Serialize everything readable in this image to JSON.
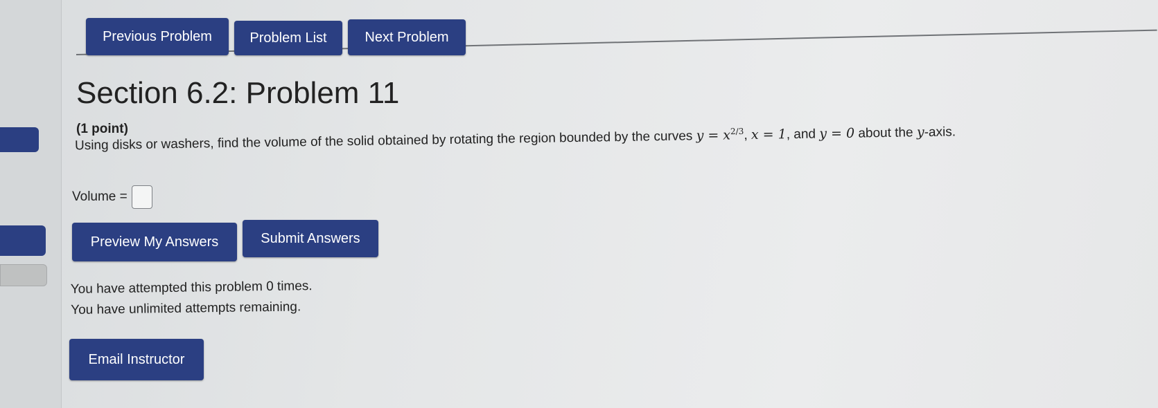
{
  "nav": {
    "previous_label": "Previous Problem",
    "list_label": "Problem List",
    "next_label": "Next Problem"
  },
  "problem": {
    "title": "Section 6.2: Problem 11",
    "points": "(1 point)",
    "question_prefix": "Using disks or washers, find the volume of the solid obtained by rotating the region bounded by the curves ",
    "eq1_lhs": "y = x",
    "eq1_exp": "2/3",
    "eq2": "x = 1",
    "conj": "and",
    "eq3": "y = 0",
    "question_suffix_pre": "about the ",
    "axis_var": "y",
    "question_suffix_post": "-axis.",
    "answer_label": "Volume =",
    "answer_value": ""
  },
  "actions": {
    "preview_label": "Preview My Answers",
    "submit_label": "Submit Answers"
  },
  "status": {
    "attempts": "You have attempted this problem 0 times.",
    "remaining": "You have unlimited attempts remaining."
  },
  "email": {
    "label": "Email Instructor"
  },
  "colors": {
    "button_bg": "#2b3f82",
    "button_text": "#ffffff",
    "page_bg": "#e6e7e8"
  }
}
